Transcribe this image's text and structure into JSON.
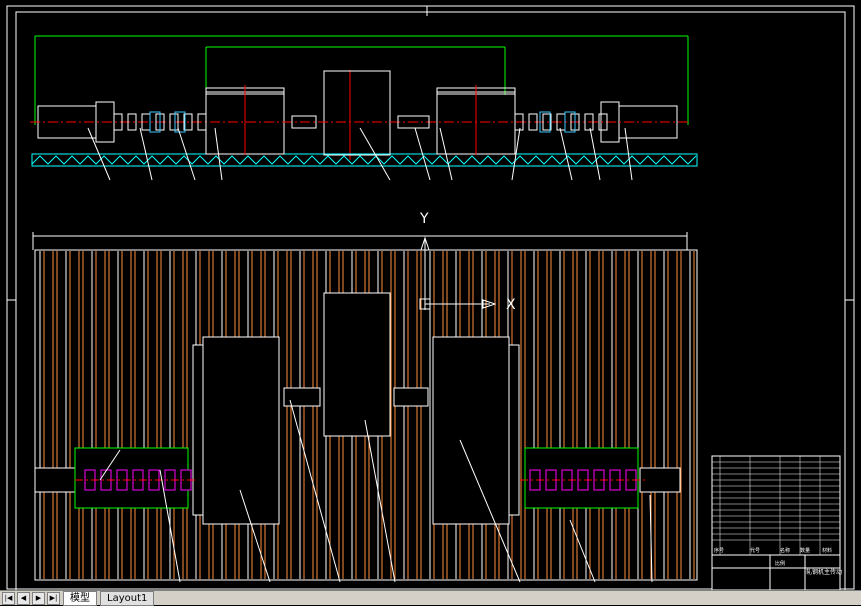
{
  "colors": {
    "background": "#000000",
    "frame": "#ffffff",
    "base": "#00ffff",
    "dimension": "#00ff00",
    "centerline": "#ff0000",
    "rail_orange": "#ff8c3c",
    "rail_white": "#ffffff",
    "magenta": "#ff00ff",
    "hatch": "#3cc8ff"
  },
  "plan_view": {
    "axis_y_label": "Y",
    "axis_x_label": "X"
  },
  "title_block": {
    "drawing_name": "轧钢机主传动",
    "header_cells": [
      "序号",
      "代号",
      "名称",
      "数量",
      "材料"
    ],
    "scale_label": "比例"
  },
  "layout_tabs": {
    "nav": [
      "|◀",
      "◀",
      "▶",
      "▶|"
    ],
    "tabs": [
      "模型",
      "Layout1"
    ]
  }
}
